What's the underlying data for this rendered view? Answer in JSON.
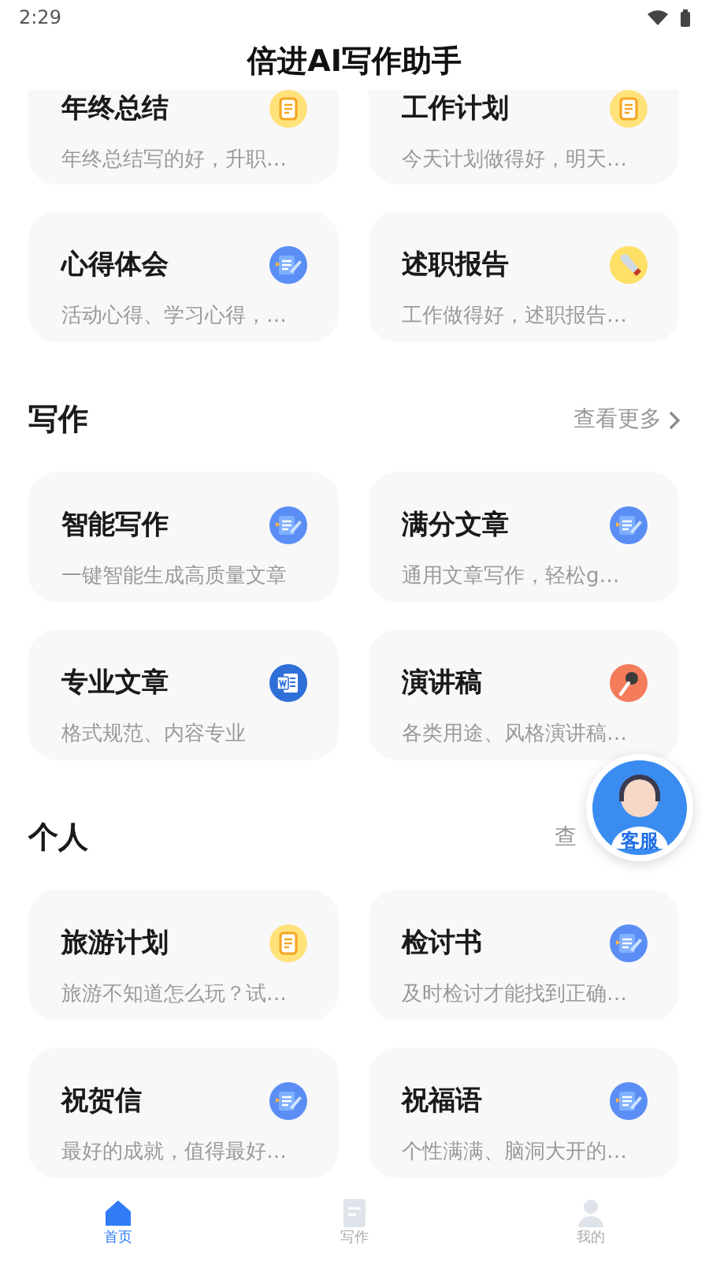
{
  "status_bar": {
    "time": "2:29"
  },
  "header": {
    "title": "倍进AI写作助手"
  },
  "sections": [
    {
      "cut": true,
      "cards": [
        {
          "title": "年终总结",
          "desc": "年终总结写的好，升职…",
          "kind": "note"
        },
        {
          "title": "工作计划",
          "desc": "今天计划做得好，明天…",
          "kind": "note"
        },
        {
          "title": "心得体会",
          "desc": "活动心得、学习心得，…",
          "kind": "edit"
        },
        {
          "title": "述职报告",
          "desc": "工作做得好，述职报告…",
          "kind": "pen"
        }
      ]
    },
    {
      "heading": "写作",
      "more": "查看更多",
      "more_arrow": true,
      "cards": [
        {
          "title": "智能写作",
          "desc": "一键智能生成高质量文章",
          "kind": "edit"
        },
        {
          "title": "满分文章",
          "desc": "通用文章写作，轻松g…",
          "kind": "edit"
        },
        {
          "title": "专业文章",
          "desc": "格式规范、内容专业",
          "kind": "word"
        },
        {
          "title": "演讲稿",
          "desc": "各类用途、风格演讲稿…",
          "kind": "mic"
        }
      ]
    },
    {
      "heading": "个人",
      "more": "查",
      "more_arrow": false,
      "cards": [
        {
          "title": "旅游计划",
          "desc": "旅游不知道怎么玩？试…",
          "kind": "note"
        },
        {
          "title": "检讨书",
          "desc": "及时检讨才能找到正确…",
          "kind": "edit"
        },
        {
          "title": "祝贺信",
          "desc": "最好的成就，值得最好…",
          "kind": "edit"
        },
        {
          "title": "祝福语",
          "desc": "个性满满、脑洞大开的…",
          "kind": "edit"
        }
      ]
    }
  ],
  "service_button": {
    "label": "客服"
  },
  "bottom_nav": [
    {
      "label": "首页",
      "kind": "home",
      "selected": true
    },
    {
      "label": "写作",
      "kind": "doc",
      "selected": false
    },
    {
      "label": "我的",
      "kind": "person",
      "selected": false
    }
  ]
}
